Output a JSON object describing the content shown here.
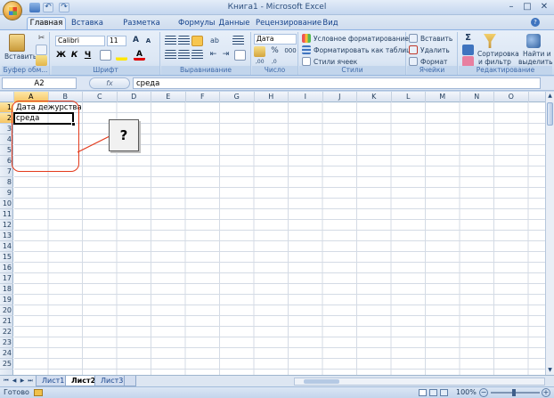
{
  "window": {
    "title": "Книга1 - Microsoft Excel",
    "min_glyph": "–",
    "max_glyph": "□",
    "close_glyph": "✕"
  },
  "ribbon_tabs": [
    "Главная",
    "Вставка",
    "Разметка страницы",
    "Формулы",
    "Данные",
    "Рецензирование",
    "Вид"
  ],
  "active_tab": "Главная",
  "groups": {
    "clipboard": {
      "name": "Буфер обм...",
      "paste": "Вставить"
    },
    "font": {
      "name": "Шрифт",
      "font_family": "Calibri",
      "font_size": "11",
      "bold": "Ж",
      "italic": "К",
      "underline": "Ч",
      "grow": "A",
      "shrink": "A"
    },
    "alignment": {
      "name": "Выравнивание"
    },
    "number": {
      "name": "Число",
      "format": "Дата",
      "percent": "%",
      "thousands": "000"
    },
    "styles": {
      "name": "Стили",
      "conditional": "Условное форматирование",
      "as_table": "Форматировать как таблицу",
      "cell_styles": "Стили ячеек"
    },
    "cells": {
      "name": "Ячейки",
      "insert": "Вставить",
      "delete": "Удалить",
      "format": "Формат"
    },
    "editing": {
      "name": "Редактирование",
      "sigma": "Σ",
      "sort_line1": "Сортировка",
      "sort_line2": "и фильтр",
      "find_line1": "Найти и",
      "find_line2": "выделить"
    }
  },
  "formula_bar": {
    "name_box": "A2",
    "fx": "fx",
    "content": "среда"
  },
  "columns": [
    "A",
    "B",
    "C",
    "D",
    "E",
    "F",
    "G",
    "H",
    "I",
    "J",
    "K",
    "L",
    "M",
    "N",
    "O"
  ],
  "rows": [
    "1",
    "2",
    "3",
    "4",
    "5",
    "6",
    "7",
    "8",
    "9",
    "10",
    "11",
    "12",
    "13",
    "14",
    "15",
    "16",
    "17",
    "18",
    "19",
    "20",
    "21",
    "22",
    "23",
    "24",
    "25"
  ],
  "cells": {
    "A1": "Дата дежурства",
    "A2": "среда"
  },
  "selected_cell": "A2",
  "annotation": {
    "label": "?"
  },
  "sheets": [
    "Лист1",
    "Лист2",
    "Лист3"
  ],
  "active_sheet": "Лист2",
  "status": {
    "ready": "Готово",
    "zoom": "100%"
  }
}
